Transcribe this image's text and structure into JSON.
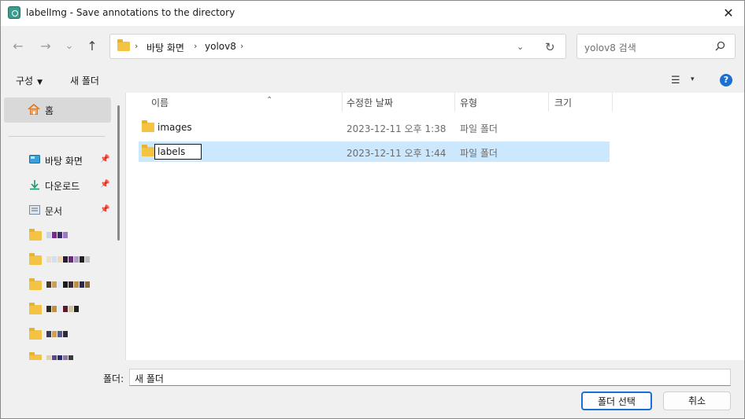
{
  "window": {
    "title": "labelImg - Save annotations to the directory",
    "close": "✕"
  },
  "nav": {
    "back": "←",
    "forward": "→",
    "recent": "⌄",
    "up": "↑"
  },
  "address": {
    "crumbs": [
      "바탕 화면",
      "yolov8"
    ],
    "separator": "›",
    "dropdown": "⌄",
    "refresh": "↻"
  },
  "search": {
    "placeholder": "yolov8 검색"
  },
  "command": {
    "organize": "구성",
    "new_folder": "새 폴더",
    "view_icon": "☰",
    "view_caret": "▾",
    "help": "?"
  },
  "sidebar": {
    "home": "홈",
    "quick_access": [
      {
        "label": "바탕 화면",
        "icon": "desktop-icon"
      },
      {
        "label": "다운로드",
        "icon": "download-icon"
      },
      {
        "label": "문서",
        "icon": "documents-icon"
      }
    ]
  },
  "columns": {
    "name": "이름",
    "modified": "수정한 날짜",
    "type": "유형",
    "size": "크기"
  },
  "files": [
    {
      "name": "images",
      "modified": "2023-12-11 오후 1:38",
      "type": "파일 폴더",
      "selected": false
    },
    {
      "name": "labels",
      "modified": "2023-12-11 오후 1:44",
      "type": "파일 폴더",
      "selected": true
    }
  ],
  "footer": {
    "folder_label": "폴더:",
    "folder_value": "새 폴더",
    "select_button": "폴더 선택",
    "cancel_button": "취소"
  },
  "colors": {
    "accent": "#1a6fd0",
    "selection": "#cce8ff",
    "folder": "#f4c344"
  }
}
